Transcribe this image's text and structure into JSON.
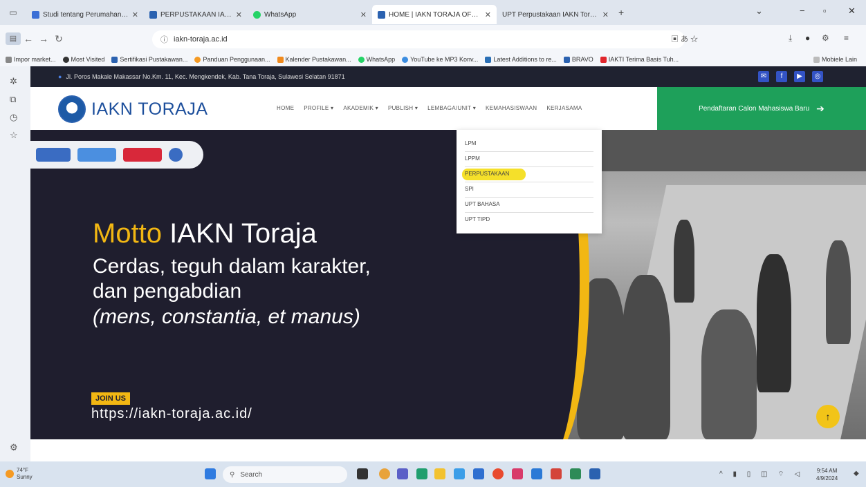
{
  "browser": {
    "tabs": [
      {
        "title": "Studi tentang Perumahan Wo",
        "color": "#3b6fd6"
      },
      {
        "title": "PERPUSTAKAAN IAKN TORAJA",
        "color": "#2b62b0"
      },
      {
        "title": "WhatsApp",
        "color": "#25d366"
      },
      {
        "title": "HOME | IAKN TORAJA OFFICIAL",
        "color": "#2b62b0"
      },
      {
        "title": "UPT Perpustakaan IAKN Toraja",
        "color": "#888888"
      }
    ],
    "address": "iakn-toraja.ac.id",
    "bookmarks": [
      "Impor market...",
      "Most Visited",
      "Sertifikasi Pustakawan...",
      "Panduan Penggunaan...",
      "Kalender Pustakawan...",
      "WhatsApp",
      "YouTube ke MP3 Konv...",
      "Latest Additions to re...",
      "BRAVO",
      "IAKTI Terima Basis Tuh..."
    ],
    "bookmarks_other": "Mobiele Lain"
  },
  "site": {
    "address_line": "Jl. Poros Makale Makassar No.Km. 11, Kec. Mengkendek, Kab. Tana Toraja, Sulawesi Selatan 91871",
    "brand": "IAKN TORAJA",
    "menu": [
      "HOME",
      "PROFILE ▾",
      "AKADEMIK ▾",
      "PUBLISH ▾",
      "LEMBAGA/UNIT ▾",
      "KEMAHASISWAAN",
      "KERJASAMA"
    ],
    "cta": "Pendaftaran Calon Mahasiswa Baru",
    "dropdown": [
      "LPM",
      "LPPM",
      "PERPUSTAKAAN",
      "SPI",
      "UPT BAHASA",
      "UPT TIPD"
    ],
    "hero": {
      "motto_highlight": "Motto",
      "motto_rest": " IAKN Toraja",
      "line1": "Cerdas, teguh dalam karakter,",
      "line2": "dan pengabdian",
      "line3": "(mens, constantia, et manus)",
      "join": "JOIN US",
      "url": "https://iakn-toraja.ac.id/"
    }
  },
  "taskbar": {
    "weather_temp": "74°F",
    "weather_desc": "Sunny",
    "search": "Search",
    "time": "9:54 AM",
    "date": "4/9/2024"
  },
  "colors": {
    "accent": "#f2b713",
    "cta": "#1ea05a",
    "dark": "#1f1e2e",
    "brand": "#1d4f9c"
  }
}
